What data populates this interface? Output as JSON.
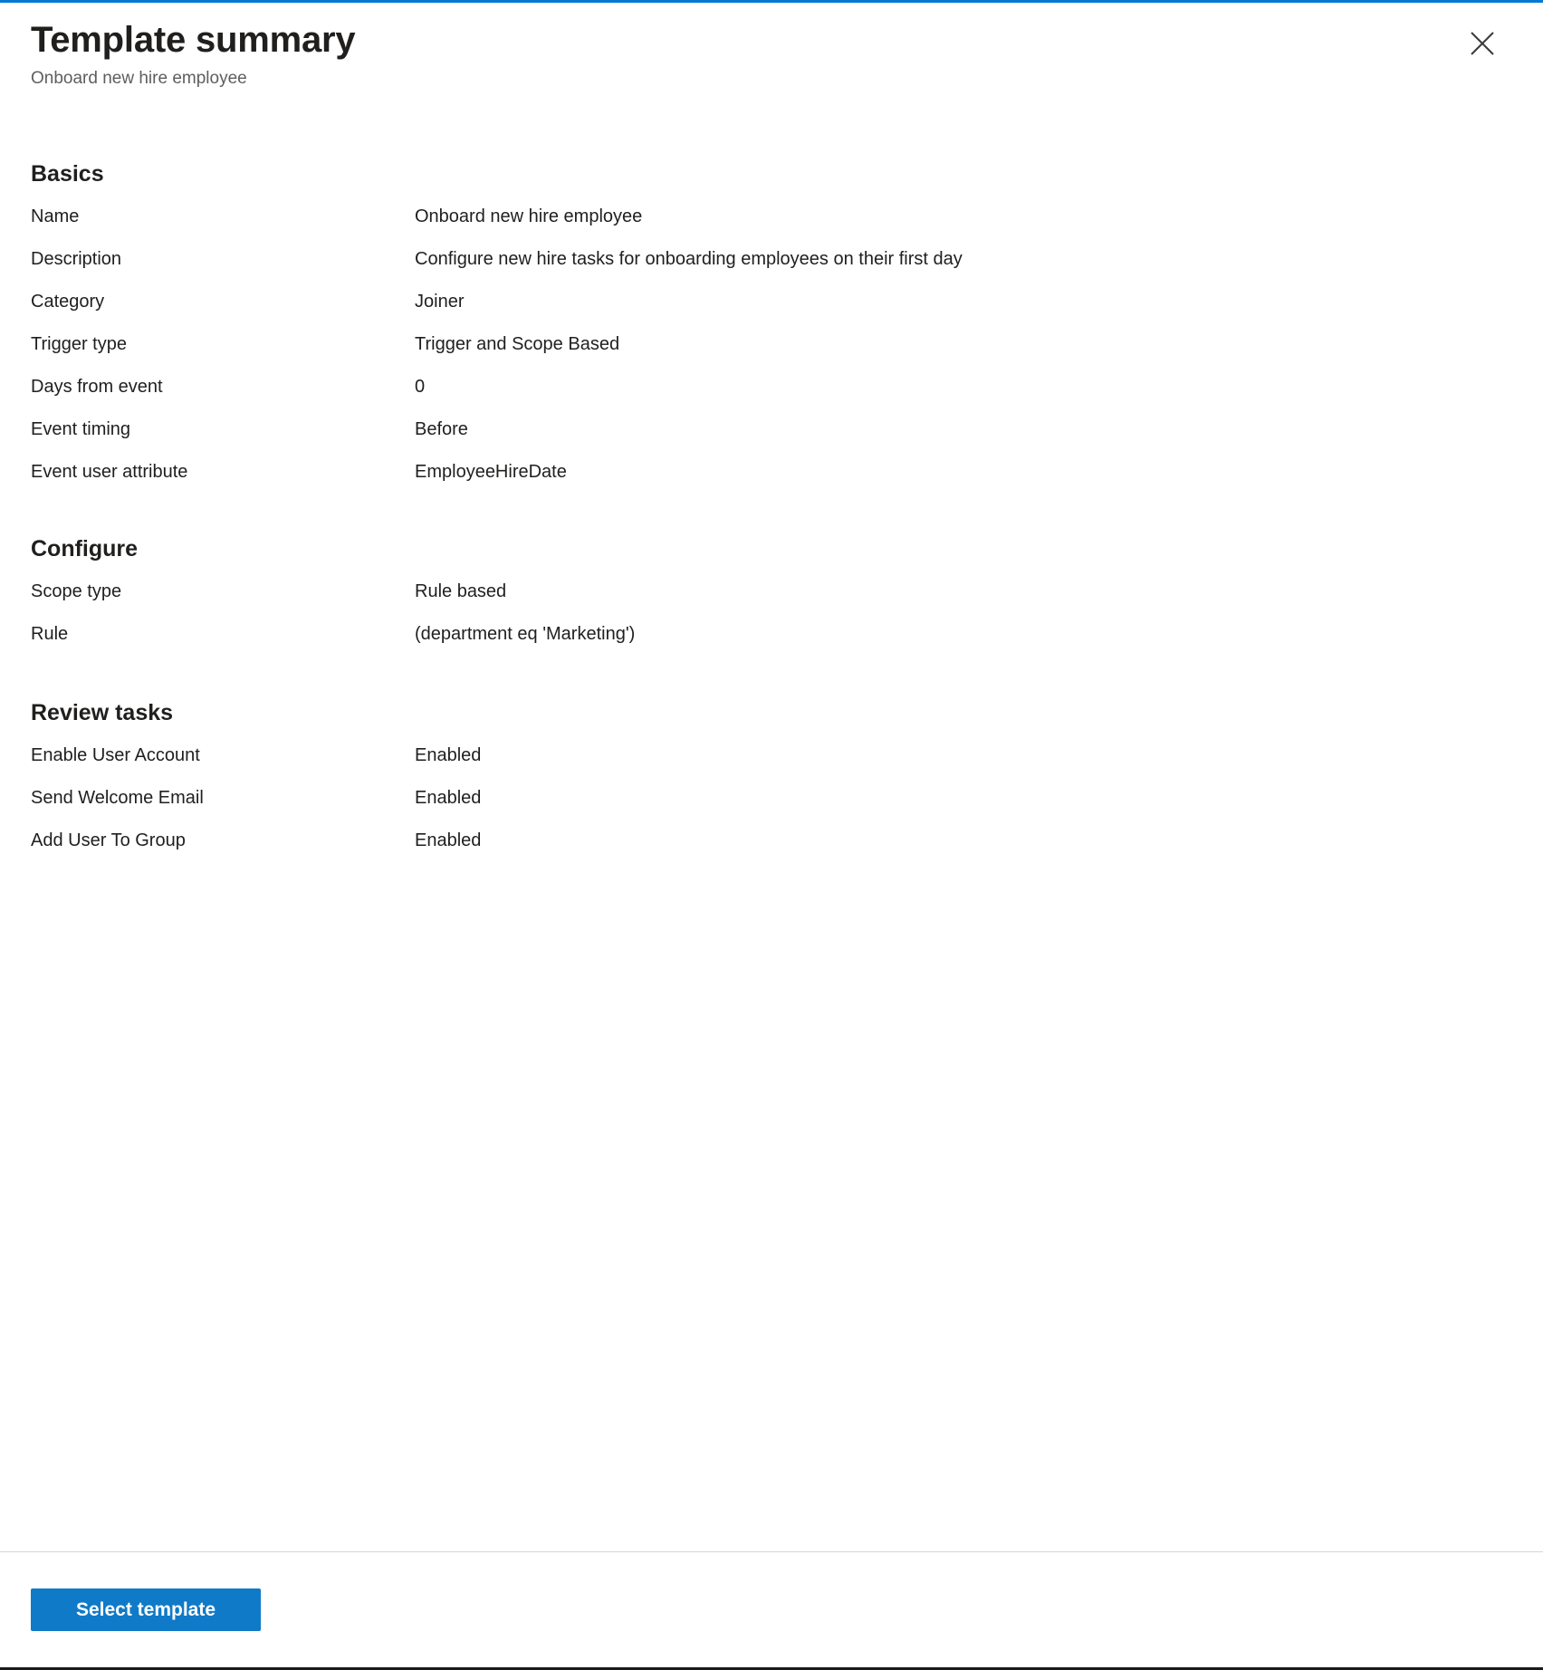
{
  "header": {
    "title": "Template summary",
    "subtitle": "Onboard new hire employee",
    "close_icon": "close-icon"
  },
  "sections": [
    {
      "id": "basics",
      "heading": "Basics",
      "rows": [
        {
          "label": "Name",
          "value": "Onboard new hire employee"
        },
        {
          "label": "Description",
          "value": "Configure new hire tasks for onboarding employees on their first day"
        },
        {
          "label": "Category",
          "value": "Joiner"
        },
        {
          "label": "Trigger type",
          "value": "Trigger and Scope Based"
        },
        {
          "label": "Days from event",
          "value": "0"
        },
        {
          "label": "Event timing",
          "value": "Before"
        },
        {
          "label": "Event user attribute",
          "value": "EmployeeHireDate"
        }
      ]
    },
    {
      "id": "configure",
      "heading": "Configure",
      "rows": [
        {
          "label": "Scope type",
          "value": "Rule based"
        },
        {
          "label": "Rule",
          "value": "(department eq 'Marketing')"
        }
      ]
    },
    {
      "id": "review",
      "heading": "Review tasks",
      "rows": [
        {
          "label": "Enable User Account",
          "value": "Enabled"
        },
        {
          "label": "Send Welcome Email",
          "value": "Enabled"
        },
        {
          "label": "Add User To Group",
          "value": "Enabled"
        }
      ]
    }
  ],
  "footer": {
    "select_template_label": "Select template"
  },
  "colors": {
    "accent": "#0078d4",
    "button": "#0f7ac8",
    "text": "#201f1e",
    "muted": "#605e5c",
    "divider": "#d6d6d6",
    "bottom_border": "#1b1a19"
  }
}
